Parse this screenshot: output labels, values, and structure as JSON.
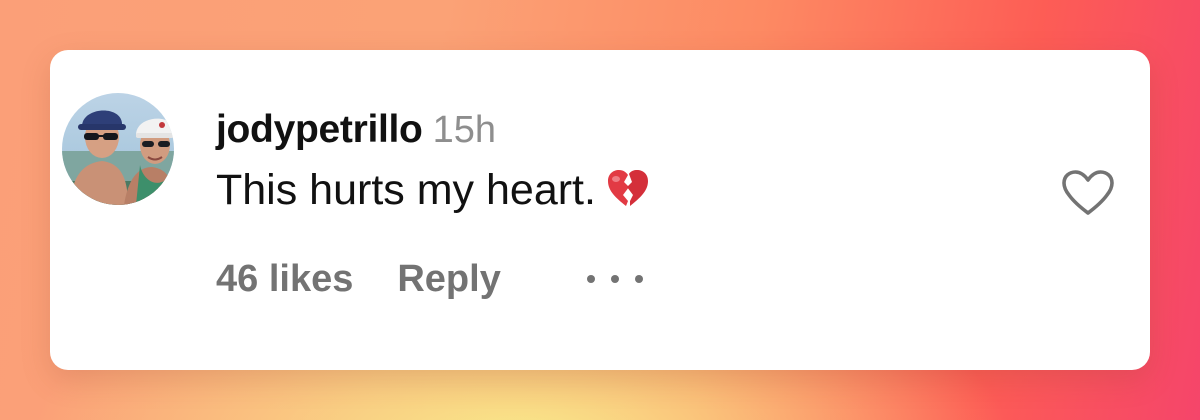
{
  "comment": {
    "username": "jodypetrillo",
    "timestamp": "15h",
    "text": "This hurts my heart.",
    "emoji": "broken-heart",
    "likes_label": "46 likes",
    "reply_label": "Reply",
    "more_icon": "more-options-icon",
    "like_icon": "heart-outline-icon",
    "avatar": "profile-photo"
  },
  "colors": {
    "username": "#111111",
    "secondary": "#737373",
    "timestamp": "#8e8e8e",
    "emoji_red": "#e23a44",
    "card": "#ffffff"
  }
}
